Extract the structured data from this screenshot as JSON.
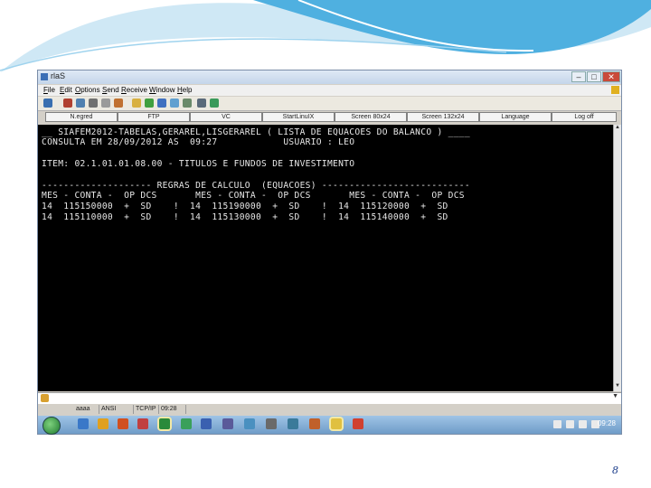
{
  "window": {
    "title": "rlaS"
  },
  "menu": [
    "File",
    "Edit",
    "Options",
    "Send",
    "Receive",
    "Window",
    "Help"
  ],
  "fkeys": [
    "N.egred",
    "FTP",
    "VC",
    "StartLinuIX",
    "Screen 80x24",
    "Screen 132x24",
    "Language",
    "Log off"
  ],
  "terminal": {
    "lines": [
      "__ SIAFEM2012-TABELAS,GERAREL,LISGERAREL ( LISTA DE EQUACOES DO BALANCO ) ____",
      "CONSULTA EM 28/09/2012 AS  09:27            USUARIO : LEO",
      "",
      "ITEM: 02.1.01.01.08.00 - TITULOS E FUNDOS DE INVESTIMENTO",
      "",
      "-------------------- REGRAS DE CALCULO  (EQUACOES) ---------------------------",
      "MES - CONTA -  OP DCS       MES - CONTA -  OP DCS       MES - CONTA -  OP DCS",
      "14  115150000  +  SD    !  14  115190000  +  SD    !  14  115120000  +  SD",
      "14  115110000  +  SD    !  14  115130000  +  SD    !  14  115140000  +  SD"
    ]
  },
  "status": {
    "session": "aaaa",
    "encoding": "ANSI",
    "protocol": "TCP/IP",
    "time": "09:28"
  },
  "taskbar": {
    "clock": "09:28"
  },
  "slide": {
    "page_number": "8"
  },
  "colors": {
    "terminal_bg": "#000000",
    "terminal_fg": "#e8e8e8",
    "accent": "#1a3c8a"
  }
}
